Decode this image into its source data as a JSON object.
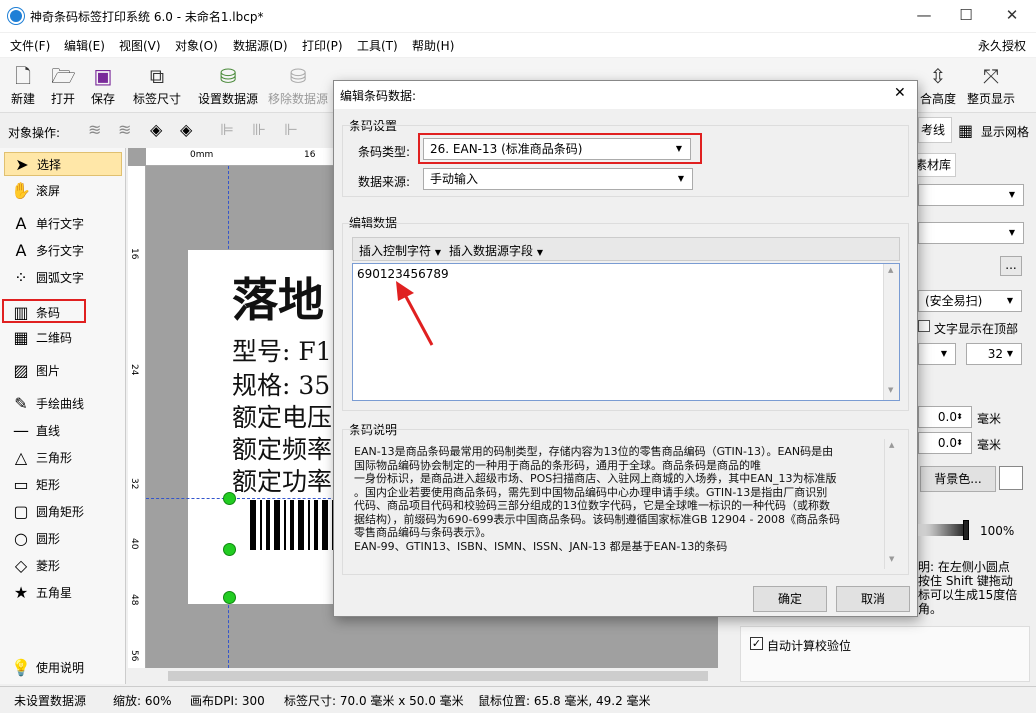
{
  "window": {
    "title": "神奇条码标签打印系统 6.0 - 未命名1.lbcp*",
    "minimize": "—",
    "maximize": "☐",
    "close": "✕"
  },
  "menu": [
    "文件(F)",
    "编辑(E)",
    "视图(V)",
    "对象(O)",
    "数据源(D)",
    "打印(P)",
    "工具(T)",
    "帮助(H)"
  ],
  "menu_right": "永久授权",
  "toolbar": [
    {
      "label": "新建",
      "icon": "new-file-icon"
    },
    {
      "label": "打开",
      "icon": "open-folder-icon"
    },
    {
      "label": "保存",
      "icon": "save-icon"
    },
    {
      "label": "标签尺寸",
      "icon": "label-size-icon"
    },
    {
      "label": "设置数据源",
      "icon": "database-icon"
    },
    {
      "label": "移除数据源",
      "icon": "database-remove-icon"
    }
  ],
  "toolbar_right": [
    {
      "label": "合高度",
      "icon": "fit-height-icon"
    },
    {
      "label": "整页显示",
      "icon": "full-page-icon"
    }
  ],
  "objbar": {
    "label": "对象操作:",
    "ref_line": "考线",
    "show_grid": "显示网格",
    "material_tab": "素材库"
  },
  "tools": [
    {
      "label": "选择",
      "icon": "arrow-cursor-icon",
      "glyph": "➤",
      "selected": true
    },
    {
      "label": "滚屏",
      "icon": "hand-icon",
      "glyph": "✋"
    },
    {
      "label": "单行文字",
      "icon": "single-text-icon",
      "glyph": "A"
    },
    {
      "label": "多行文字",
      "icon": "multi-text-icon",
      "glyph": "A"
    },
    {
      "label": "圆弧文字",
      "icon": "arc-text-icon",
      "glyph": "⁘"
    },
    {
      "label": "条码",
      "icon": "barcode-icon",
      "glyph": "▥",
      "highlighted": true
    },
    {
      "label": "二维码",
      "icon": "qrcode-icon",
      "glyph": "▦"
    },
    {
      "label": "图片",
      "icon": "picture-icon",
      "glyph": "▨"
    },
    {
      "label": "手绘曲线",
      "icon": "pen-icon",
      "glyph": "✎"
    },
    {
      "label": "直线",
      "icon": "line-icon",
      "glyph": "—"
    },
    {
      "label": "三角形",
      "icon": "triangle-icon",
      "glyph": "△"
    },
    {
      "label": "矩形",
      "icon": "rectangle-icon",
      "glyph": "▭"
    },
    {
      "label": "圆角矩形",
      "icon": "rounded-rect-icon",
      "glyph": "▢"
    },
    {
      "label": "圆形",
      "icon": "circle-icon",
      "glyph": "○"
    },
    {
      "label": "菱形",
      "icon": "diamond-icon",
      "glyph": "◇"
    },
    {
      "label": "五角星",
      "icon": "star-icon",
      "glyph": "★"
    },
    {
      "label": "使用说明",
      "icon": "lightbulb-icon",
      "glyph": "💡"
    }
  ],
  "ruler": {
    "h": [
      "0mm",
      "16"
    ],
    "v": [
      "16",
      "24",
      "32",
      "40",
      "48",
      "56"
    ]
  },
  "label": {
    "line1": "落地",
    "line2": "型号: F1",
    "line3": "规格: 35",
    "line4": "额定电压",
    "line5": "额定频率",
    "line6": "额定功率"
  },
  "right": {
    "safe_select": "(安全易扫)",
    "text_top": "文字显示在顶部",
    "size_value": "32",
    "x_val": "0.0",
    "y_val": "0.0",
    "unit": "毫米",
    "bg_color": "背景色...",
    "opacity": "100%",
    "help": [
      "明: 在左侧小圆点",
      "按住 Shift 键拖动",
      "标可以生成15度倍",
      "角。"
    ],
    "auto_check": "自动计算校验位"
  },
  "dialog": {
    "title": "编辑条码数据:",
    "close": "✕",
    "settings_group": "条码设置",
    "type_label": "条码类型:",
    "type_value": "26.  EAN-13 (标准商品条码)",
    "source_label": "数据来源:",
    "source_value": "手动输入",
    "edit_group": "编辑数据",
    "insert_ctrl": "插入控制字符",
    "insert_field": "插入数据源字段",
    "data_value": "690123456789",
    "desc_group": "条码说明",
    "desc_lines": [
      "EAN-13是商品条码最常用的码制类型，存储内容为13位的零售商品编码（GTIN-13）。EAN码是由",
      "国际物品编码协会制定的一种用于商品的条形码，通用于全球。商品条码是商品的唯",
      "一身份标识，是商品进入超级市场、POS扫描商店、入驻网上商城的入场券，其中EAN_13为标准版",
      "。国内企业若要使用商品条码，需先到中国物品编码中心办理申请手续。GTIN-13是指由厂商识别",
      "代码、商品项目代码和校验码三部分组成的13位数字代码，它是全球唯一标识的一种代码（或称数",
      "据结构），前缀码为690-699表示中国商品条码。该码制遵循国家标准GB 12904 - 2008《商品条码",
      "零售商品编码与条码表示》。",
      "EAN-99、GTIN13、ISBN、ISMN、ISSN、JAN-13 都是基于EAN-13的条码"
    ],
    "ok": "确定",
    "cancel": "取消"
  },
  "status": {
    "datasource": "未设置数据源",
    "zoom": "缩放: 60%",
    "dpi": "画布DPI: 300",
    "size": "标签尺寸: 70.0 毫米 x 50.0 毫米",
    "mouse": "鼠标位置: 65.8 毫米, 49.2 毫米"
  },
  "colors": {
    "accent": "#1e7fd6",
    "highlight": "#e02020",
    "selected_tool": "#ffe7a8",
    "handle": "#22cc22"
  }
}
